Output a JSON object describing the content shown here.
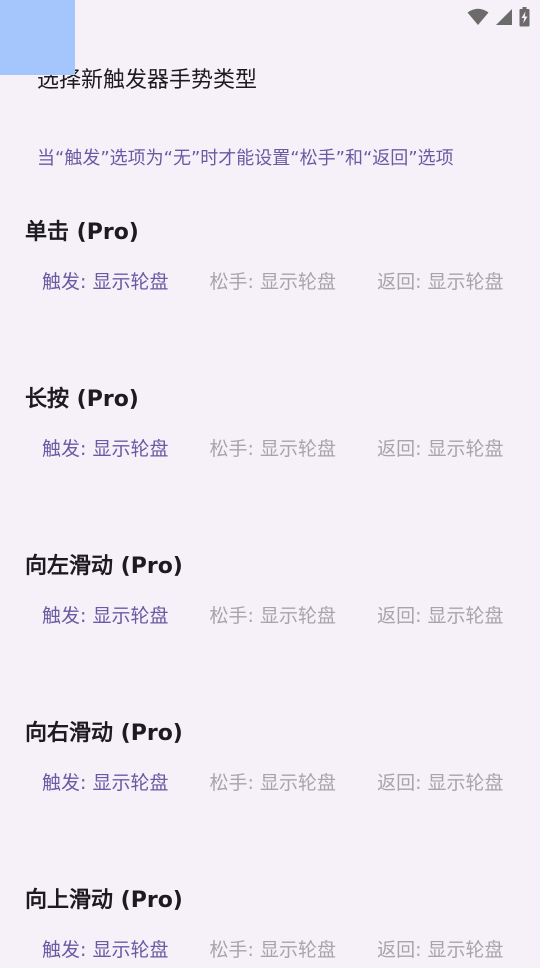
{
  "page": {
    "title": "选择新触发器手势类型",
    "hint": "当“触发”选项为“无”时才能设置“松手”和“返回”选项"
  },
  "status_bar": {
    "icons": [
      "wifi-icon",
      "signal-icon",
      "battery-charging-icon"
    ]
  },
  "colors": {
    "background": "#f6f1f9",
    "accent": "#6a5aa3",
    "disabled": "#a7a4ab",
    "overlay": "#a5c5fd"
  },
  "gestures": [
    {
      "title": "单击 (Pro)",
      "trigger": "触发: 显示轮盘",
      "release": "松手: 显示轮盘",
      "back": "返回: 显示轮盘"
    },
    {
      "title": "长按 (Pro)",
      "trigger": "触发: 显示轮盘",
      "release": "松手: 显示轮盘",
      "back": "返回: 显示轮盘"
    },
    {
      "title": "向左滑动 (Pro)",
      "trigger": "触发: 显示轮盘",
      "release": "松手: 显示轮盘",
      "back": "返回: 显示轮盘"
    },
    {
      "title": "向右滑动 (Pro)",
      "trigger": "触发: 显示轮盘",
      "release": "松手: 显示轮盘",
      "back": "返回: 显示轮盘"
    },
    {
      "title": "向上滑动 (Pro)",
      "trigger": "触发: 显示轮盘",
      "release": "松手: 显示轮盘",
      "back": "返回: 显示轮盘"
    }
  ]
}
